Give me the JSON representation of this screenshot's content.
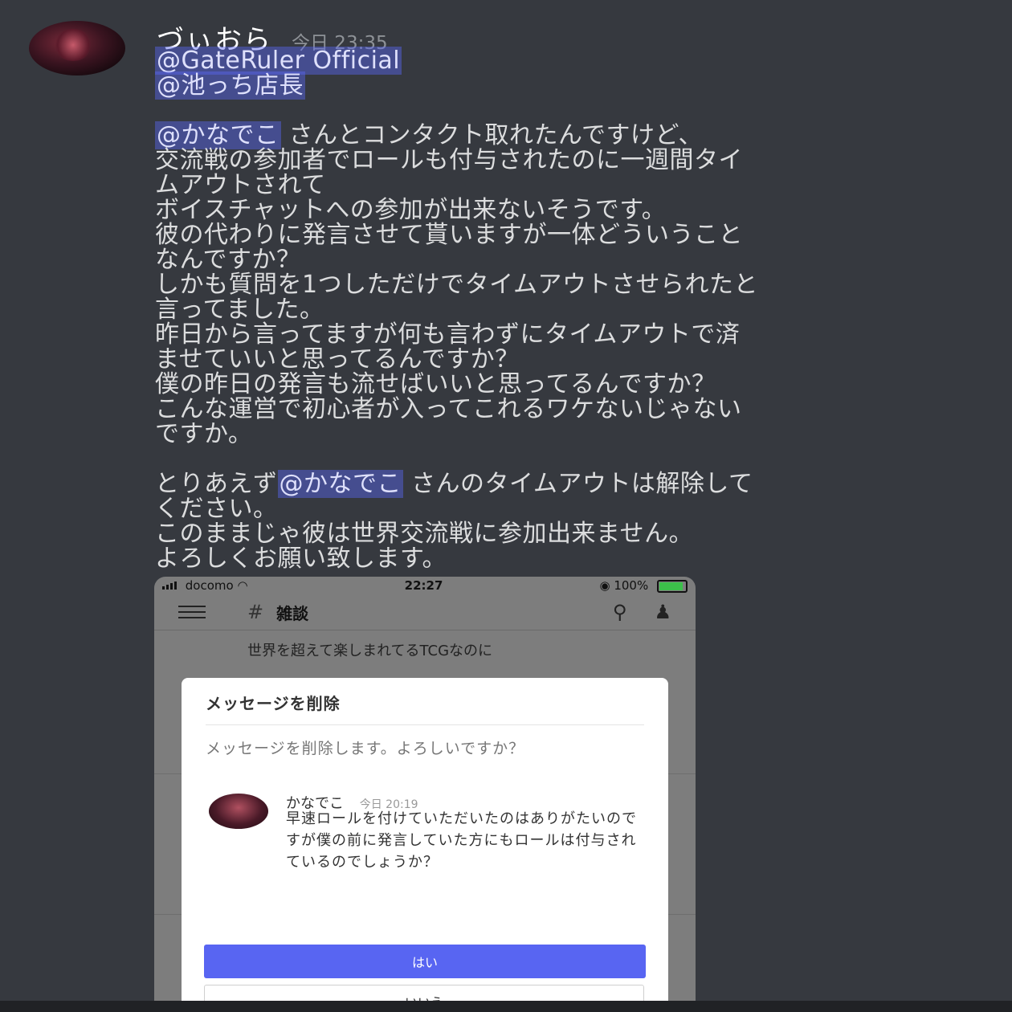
{
  "message": {
    "username": "づぃおら",
    "timestamp": "今日 23:35",
    "lines": [
      [
        {
          "t": "@GateRuler Official",
          "m": true
        }
      ],
      [
        {
          "t": "@池っち店長",
          "m": true
        }
      ],
      [],
      [
        {
          "t": "@かなでこ",
          "m": true
        },
        {
          "t": " さんとコンタクト取れたんですけど、"
        }
      ],
      [
        {
          "t": "交流戦の参加者でロールも付与されたのに一週間タイ"
        }
      ],
      [
        {
          "t": "ムアウトされて"
        }
      ],
      [
        {
          "t": "ボイスチャットへの参加が出来ないそうです。"
        }
      ],
      [
        {
          "t": "彼の代わりに発言させて貰いますが一体どういうこと"
        }
      ],
      [
        {
          "t": "なんですか？"
        }
      ],
      [
        {
          "t": "しかも質問を1つしただけでタイムアウトさせられたと"
        }
      ],
      [
        {
          "t": "言ってました。"
        }
      ],
      [
        {
          "t": "昨日から言ってますが何も言わずにタイムアウトで済"
        }
      ],
      [
        {
          "t": "ませていいと思ってるんですか？"
        }
      ],
      [
        {
          "t": "僕の昨日の発言も流せばいいと思ってるんですか？"
        }
      ],
      [
        {
          "t": "こんな運営で初心者が入ってこれるワケないじゃない"
        }
      ],
      [
        {
          "t": "ですか。"
        }
      ],
      [],
      [
        {
          "t": "とりあえず"
        },
        {
          "t": "@かなでこ",
          "m": true
        },
        {
          "t": " さんのタイムアウトは解除して"
        }
      ],
      [
        {
          "t": "ください。"
        }
      ],
      [
        {
          "t": "このままじゃ彼は世界交流戦に参加出来ません。"
        }
      ],
      [
        {
          "t": "よろしくお願い致します。"
        }
      ]
    ]
  },
  "screenshot": {
    "status": {
      "carrier": "docomo",
      "time": "22:27",
      "battery": "100%"
    },
    "channel": {
      "hash": "#",
      "name": "雑談"
    },
    "background_message": "世界を超えて楽しまれてるTCGなのに",
    "modal": {
      "title": "メッセージを削除",
      "description": "メッセージを削除します。よろしいですか？",
      "quoted": {
        "author": "かなでこ",
        "time": "今日 20:19",
        "text": "早速ロールを付けていただいたのはありがたいのですが僕の前に発言していた方にもロールは付与されているのでしょうか？"
      },
      "confirm": "はい",
      "cancel": "いいえ"
    },
    "icons": [
      "menu-icon",
      "search-icon",
      "members-icon",
      "wifi-icon",
      "battery-icon"
    ]
  },
  "colors": {
    "background": "#36393f",
    "mention": "#5865f2",
    "confirm_button": "#5865f2"
  }
}
